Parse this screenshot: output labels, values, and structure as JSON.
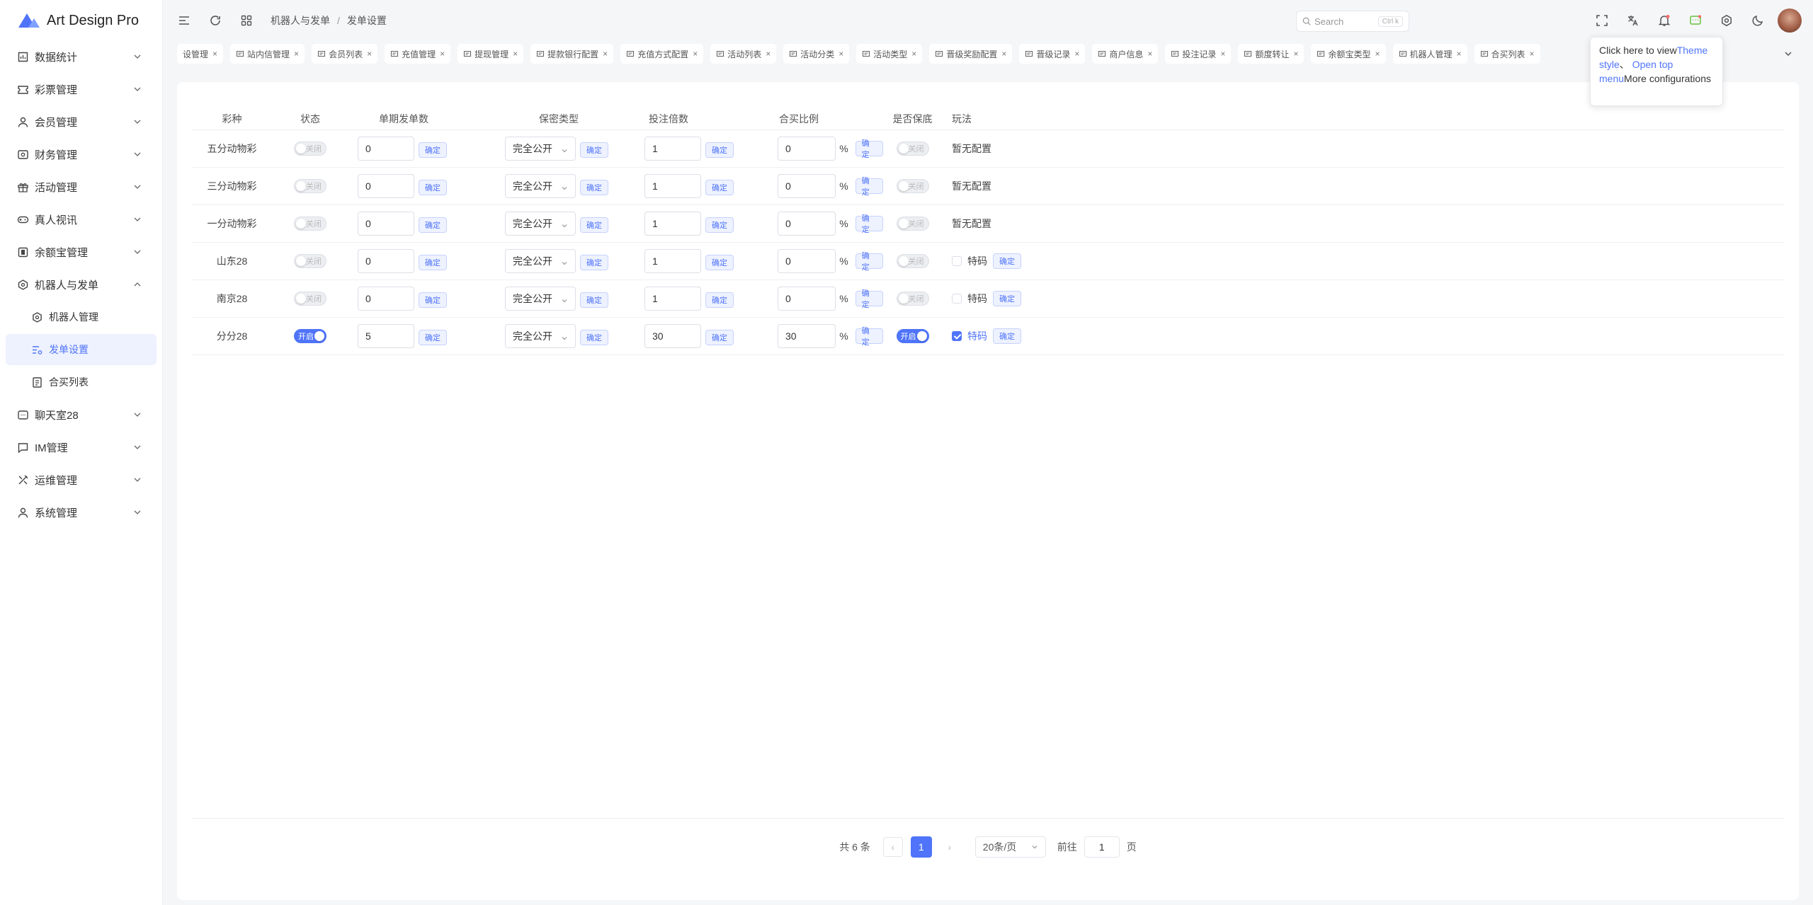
{
  "app": {
    "name": "Art Design Pro"
  },
  "sidebar": {
    "items": [
      {
        "label": "数据统计",
        "icon": "chart-icon"
      },
      {
        "label": "彩票管理",
        "icon": "ticket-icon"
      },
      {
        "label": "会员管理",
        "icon": "user-icon"
      },
      {
        "label": "财务管理",
        "icon": "wallet-icon"
      },
      {
        "label": "活动管理",
        "icon": "gift-icon"
      },
      {
        "label": "真人视讯",
        "icon": "gamepad-icon"
      },
      {
        "label": "余额宝管理",
        "icon": "safe-icon"
      },
      {
        "label": "机器人与发单",
        "icon": "robot-icon"
      },
      {
        "label": "机器人管理",
        "icon": "gear-icon"
      },
      {
        "label": "发单设置",
        "icon": "list-settings-icon"
      },
      {
        "label": "合买列表",
        "icon": "document-icon"
      },
      {
        "label": "聊天室28",
        "icon": "chat-icon"
      },
      {
        "label": "IM管理",
        "icon": "message-icon"
      },
      {
        "label": "运维管理",
        "icon": "tools-icon"
      },
      {
        "label": "系统管理",
        "icon": "user-icon"
      }
    ]
  },
  "header": {
    "breadcrumb": [
      "机器人与发单",
      "发单设置"
    ],
    "search_placeholder": "Search",
    "search_shortcut": "Ctrl k"
  },
  "tabs": [
    {
      "label": "设管理"
    },
    {
      "label": "站内信管理"
    },
    {
      "label": "会员列表"
    },
    {
      "label": "充值管理"
    },
    {
      "label": "提现管理"
    },
    {
      "label": "提款银行配置"
    },
    {
      "label": "充值方式配置"
    },
    {
      "label": "活动列表"
    },
    {
      "label": "活动分类"
    },
    {
      "label": "活动类型"
    },
    {
      "label": "晋级奖励配置"
    },
    {
      "label": "晋级记录"
    },
    {
      "label": "商户信息"
    },
    {
      "label": "投注记录"
    },
    {
      "label": "额度转让"
    },
    {
      "label": "余额宝类型"
    },
    {
      "label": "机器人管理"
    },
    {
      "label": "合买列表"
    }
  ],
  "tooltip": {
    "prefix": "Click here to view",
    "link1": "Theme style",
    "sep": "、",
    "link2": "Open top menu",
    "suffix": "More configurations"
  },
  "table": {
    "headers": [
      "彩种",
      "状态",
      "单期发单数",
      "保密类型",
      "投注倍数",
      "合买比例",
      "是否保底",
      "玩法"
    ],
    "confirm": "确定",
    "switch_on": "开启",
    "switch_off": "关闭",
    "percent": "%",
    "rows": [
      {
        "name": "五分动物彩",
        "status": false,
        "orders": "0",
        "secrecy": "完全公开",
        "multiple": "1",
        "ratio": "0",
        "guarantee": false,
        "play_text": "暂无配置"
      },
      {
        "name": "三分动物彩",
        "status": false,
        "orders": "0",
        "secrecy": "完全公开",
        "multiple": "1",
        "ratio": "0",
        "guarantee": false,
        "play_text": "暂无配置"
      },
      {
        "name": "一分动物彩",
        "status": false,
        "orders": "0",
        "secrecy": "完全公开",
        "multiple": "1",
        "ratio": "0",
        "guarantee": false,
        "play_text": "暂无配置"
      },
      {
        "name": "山东28",
        "status": false,
        "orders": "0",
        "secrecy": "完全公开",
        "multiple": "1",
        "ratio": "0",
        "guarantee": false,
        "play_check": "特码",
        "play_checked": false
      },
      {
        "name": "南京28",
        "status": false,
        "orders": "0",
        "secrecy": "完全公开",
        "multiple": "1",
        "ratio": "0",
        "guarantee": false,
        "play_check": "特码",
        "play_checked": false
      },
      {
        "name": "分分28",
        "status": true,
        "orders": "5",
        "secrecy": "完全公开",
        "multiple": "30",
        "ratio": "30",
        "guarantee": true,
        "play_check": "特码",
        "play_checked": true
      }
    ]
  },
  "pagination": {
    "total": "共 6 条",
    "current": "1",
    "page_size": "20条/页",
    "goto_prefix": "前往",
    "goto_value": "1",
    "goto_suffix": "页"
  },
  "colors": {
    "accent": "#4f74f9",
    "background": "#f5f6f8"
  }
}
